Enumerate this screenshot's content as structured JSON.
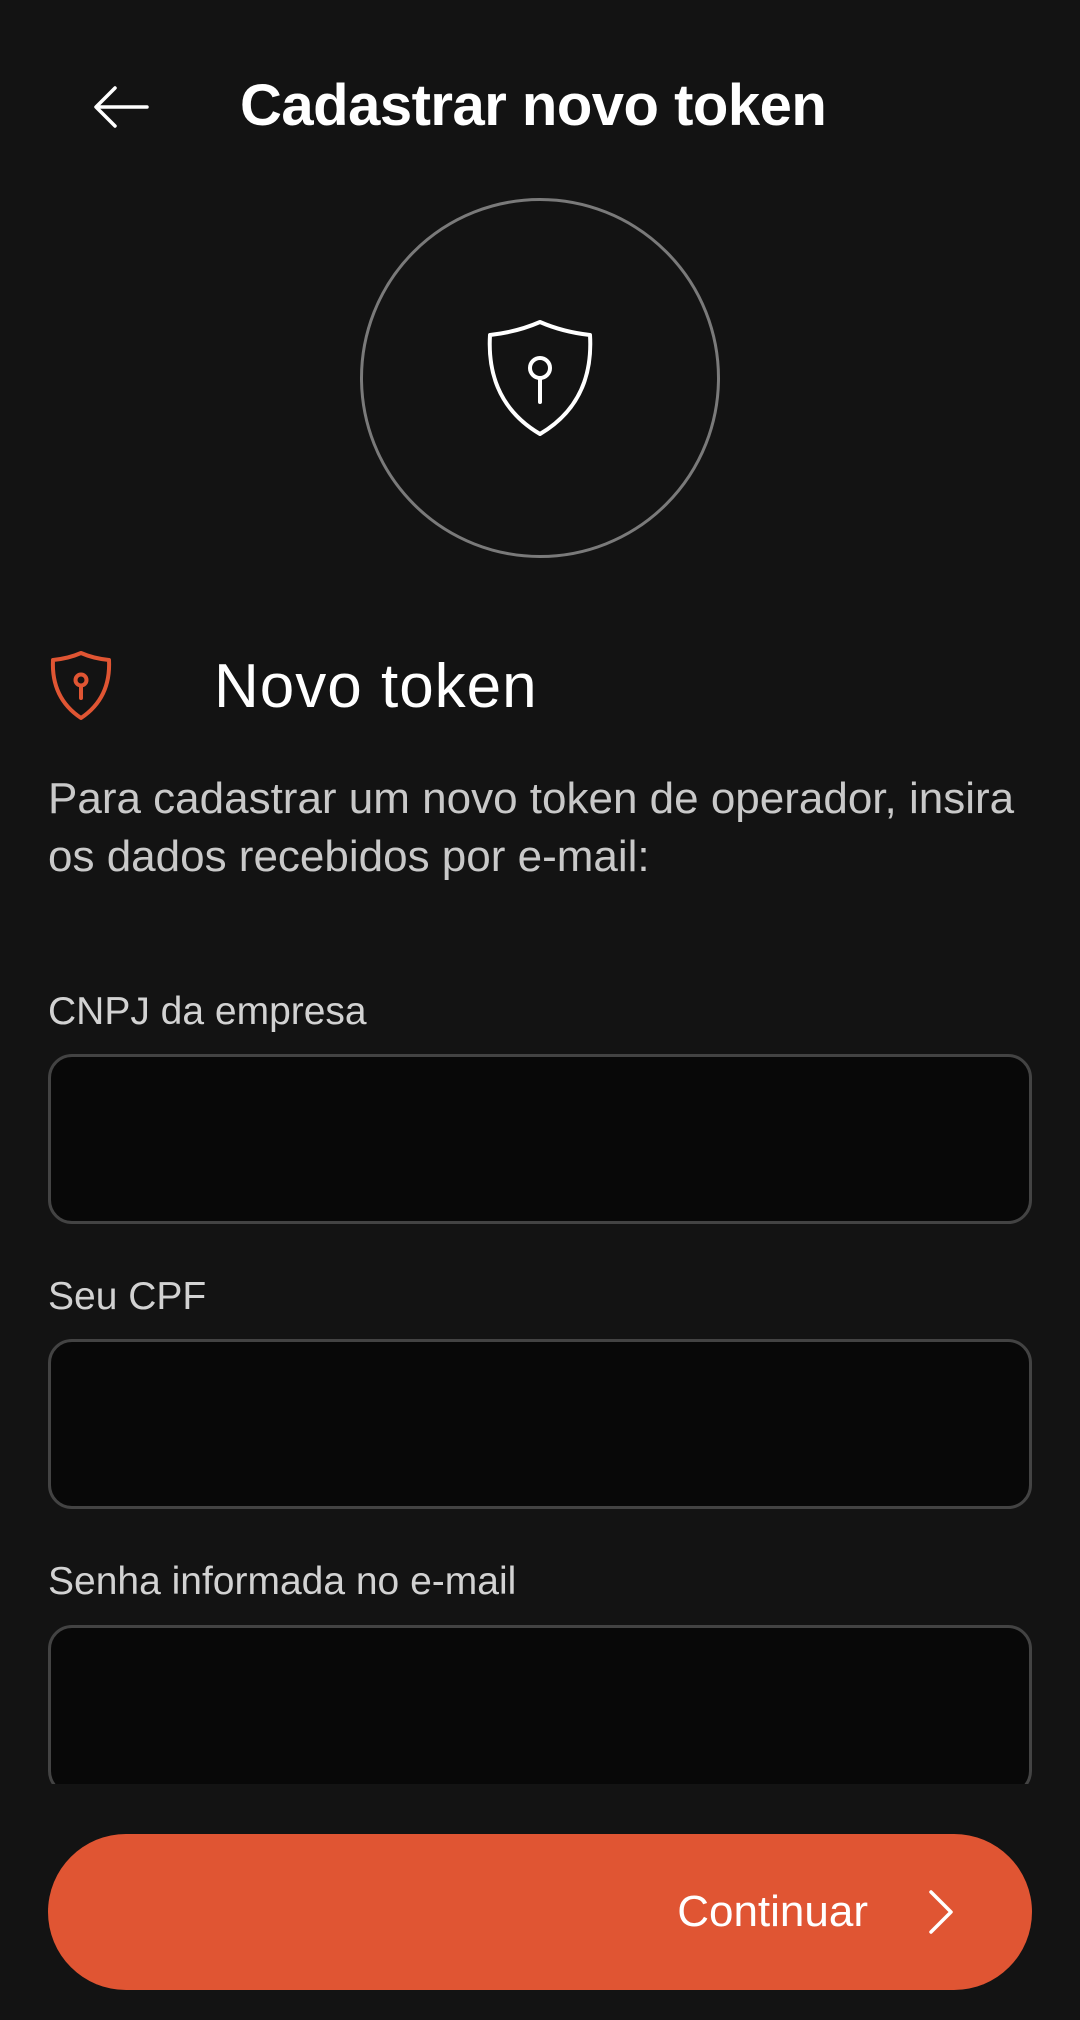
{
  "header": {
    "title": "Cadastrar novo token",
    "back_icon": "arrow-left-icon"
  },
  "hero": {
    "icon": "shield-keyhole-icon"
  },
  "section": {
    "icon": "shield-keyhole-icon",
    "title": "Novo token",
    "description": "Para cadastrar um novo token de operador, insira os dados recebidos por e-mail:"
  },
  "form": {
    "fields": [
      {
        "label": "CNPJ da empresa",
        "value": "",
        "placeholder": ""
      },
      {
        "label": "Seu CPF",
        "value": "",
        "placeholder": ""
      },
      {
        "label": "Senha informada no e-mail",
        "value": "",
        "placeholder": ""
      }
    ]
  },
  "actions": {
    "continue_label": "Continuar",
    "continue_icon": "chevron-right-icon"
  },
  "colors": {
    "background": "#131313",
    "accent": "#e05533",
    "input_bg": "#080808",
    "input_border": "#434343"
  }
}
